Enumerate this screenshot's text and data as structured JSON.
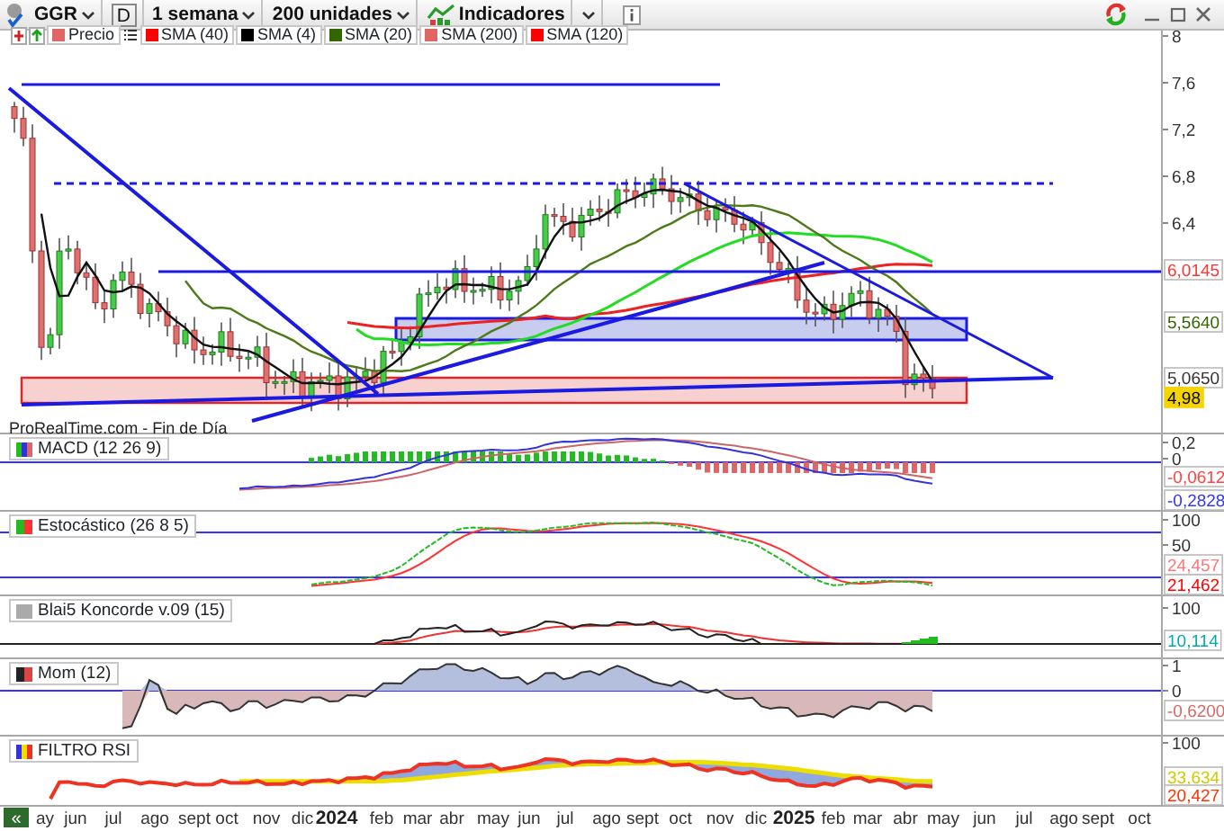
{
  "toolbar": {
    "symbol": "GGR",
    "mode": "D",
    "timeframe": "1 semana",
    "units": "200 unidades",
    "indicators": "Indicadores"
  },
  "legend": [
    {
      "label": "Precio",
      "color": "#e06666"
    },
    {
      "label": "SMA (40)",
      "color": "#ff0000"
    },
    {
      "label": "SMA (4)",
      "color": "#000000"
    },
    {
      "label": "SMA (20)",
      "color": "#336600"
    },
    {
      "label": "SMA (200)",
      "color": "#e06666"
    },
    {
      "label": "SMA (120)",
      "color": "#ff0000"
    }
  ],
  "price_panel": {
    "source": "ProRealTime.com - Fin de Día",
    "ticks": [
      "8",
      "7,6",
      "7,2",
      "6,8",
      "6,4"
    ],
    "markers": [
      {
        "text": "6,0145",
        "color": "#ff3333",
        "kind": "boxed"
      },
      {
        "text": "5,5640",
        "color": "#336600",
        "kind": "boxed"
      },
      {
        "text": "5,0650",
        "color": "#333333",
        "kind": "boxed"
      },
      {
        "text": "4,98",
        "color": "#f5d400",
        "kind": "highlight"
      }
    ]
  },
  "panels": [
    {
      "kind": "macd",
      "title": "MACD (12 26 9)",
      "ticks": [
        "0,2",
        "0"
      ],
      "markers": [
        {
          "text": "-0,0612",
          "color": "#ff4444",
          "kind": "boxed"
        },
        {
          "text": "-0,2828",
          "color": "#3333ff",
          "kind": "boxed"
        }
      ]
    },
    {
      "kind": "stochastic",
      "title": "Estocástico (26 8 5)",
      "ticks": [
        "100",
        "50"
      ],
      "markers": [
        {
          "text": "24,457",
          "color": "#ff7777",
          "kind": "boxed"
        },
        {
          "text": "21,462",
          "color": "#ff0000",
          "kind": "boxed"
        }
      ]
    },
    {
      "kind": "koncorde",
      "title": "Blai5 Koncorde v.09 (15)",
      "ticks": [
        "100"
      ],
      "markers": [
        {
          "text": "10,114",
          "color": "#00aaaa",
          "kind": "boxed"
        }
      ]
    },
    {
      "kind": "momentum",
      "title": "Mom (12)",
      "ticks": [
        "1",
        "0"
      ],
      "markers": [
        {
          "text": "-0,6200",
          "color": "#e06666",
          "kind": "boxed"
        }
      ]
    },
    {
      "kind": "rsi",
      "title": "FILTRO RSI",
      "ticks": [
        "100"
      ],
      "markers": [
        {
          "text": "33,634",
          "color": "#cccc00",
          "kind": "boxed"
        },
        {
          "text": "20,427",
          "color": "#ff3300",
          "kind": "boxed"
        }
      ]
    }
  ],
  "x_axis": {
    "scroll_button": "«",
    "labels": [
      {
        "text": "ay",
        "kind": "month"
      },
      {
        "text": "jun",
        "kind": "month"
      },
      {
        "text": "jul",
        "kind": "month"
      },
      {
        "text": "ago",
        "kind": "month"
      },
      {
        "text": "sept",
        "kind": "month"
      },
      {
        "text": "oct",
        "kind": "month"
      },
      {
        "text": "nov",
        "kind": "month"
      },
      {
        "text": "dic",
        "kind": "month"
      },
      {
        "text": "2024",
        "kind": "year"
      },
      {
        "text": "feb",
        "kind": "month"
      },
      {
        "text": "mar",
        "kind": "month"
      },
      {
        "text": "abr",
        "kind": "month"
      },
      {
        "text": "may",
        "kind": "month"
      },
      {
        "text": "jun",
        "kind": "month"
      },
      {
        "text": "jul",
        "kind": "month"
      },
      {
        "text": "ago",
        "kind": "month"
      },
      {
        "text": "sept",
        "kind": "month"
      },
      {
        "text": "oct",
        "kind": "month"
      },
      {
        "text": "nov",
        "kind": "month"
      },
      {
        "text": "dic",
        "kind": "month"
      },
      {
        "text": "2025",
        "kind": "year"
      },
      {
        "text": "feb",
        "kind": "month"
      },
      {
        "text": "mar",
        "kind": "month"
      },
      {
        "text": "abr",
        "kind": "month"
      },
      {
        "text": "may",
        "kind": "month"
      },
      {
        "text": "jun",
        "kind": "month"
      },
      {
        "text": "jul",
        "kind": "month"
      },
      {
        "text": "ago",
        "kind": "month"
      },
      {
        "text": "sept",
        "kind": "month"
      },
      {
        "text": "oct",
        "kind": "month"
      }
    ]
  }
}
